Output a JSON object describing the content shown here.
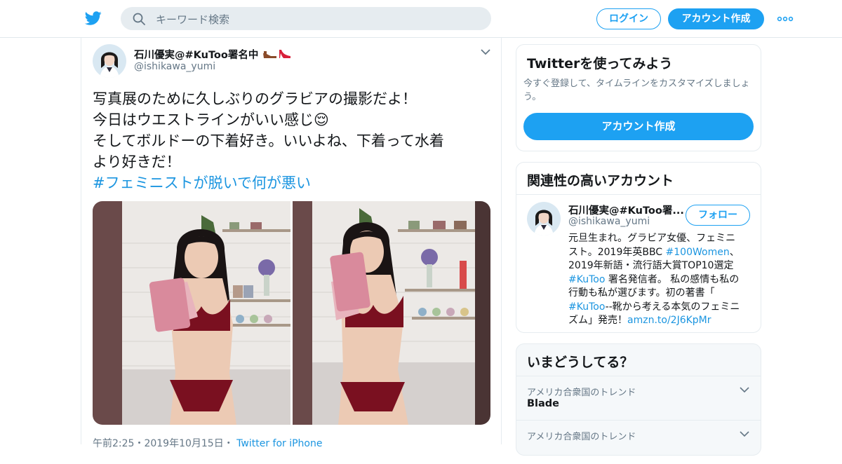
{
  "topbar": {
    "search_placeholder": "キーワード検索",
    "login_label": "ログイン",
    "signup_label": "アカウント作成"
  },
  "tweet": {
    "author_name": "石川優実@#KuToo署名中",
    "author_handle": "@ishikawa_yumi",
    "text_lines": [
      "写真展のために久しぶりのグラビアの撮影だよ！",
      "今日はウエストラインがいい感じ😌",
      "そしてボルドーの下着好き。いいよね、下着って水着",
      "より好きだ！"
    ],
    "hashtag": "#フェミニストが脱いで何が悪い",
    "timestamp": "午前2:25・2019年10月15日・",
    "source": "Twitter for iPhone"
  },
  "sidebar": {
    "try_card": {
      "title": "Twitterを使ってみよう",
      "description": "今すぐ登録して、タイムラインをカスタマイズしましょう。",
      "button_label": "アカウント作成"
    },
    "related": {
      "title": "関連性の高いアカウント",
      "account_name": "石川優実@#KuToo署...",
      "account_handle": "@ishikawa_yumi",
      "follow_label": "フォロー",
      "bio": {
        "l1": "元旦生まれ。グラビア女優、フェミニ",
        "l2a": "スト。2019年英BBC ",
        "l2_link": "#100Women",
        "l2b": "、",
        "l3": "2019年新語・流行語大賞TOP10選定",
        "l4_link": "#KuToo",
        "l4b": " 署名発信者。 私の感情も私の",
        "l5": "行動も私が選びます。初の著書「",
        "l6_link": "#KuToo",
        "l6b": "--靴から考える本気のフェミニ",
        "l7a": "ズム」発売！",
        "l7_link": "amzn.to/2J6KpMr"
      }
    },
    "trends": {
      "title": "いまどうしてる？",
      "items": [
        {
          "context": "アメリカ合衆国のトレンド",
          "name": "Blade"
        },
        {
          "context": "アメリカ合衆国のトレンド",
          "name": ""
        }
      ]
    }
  },
  "colors": {
    "accent": "#1da1f2",
    "link": "#1b95e0",
    "muted": "#657786"
  }
}
